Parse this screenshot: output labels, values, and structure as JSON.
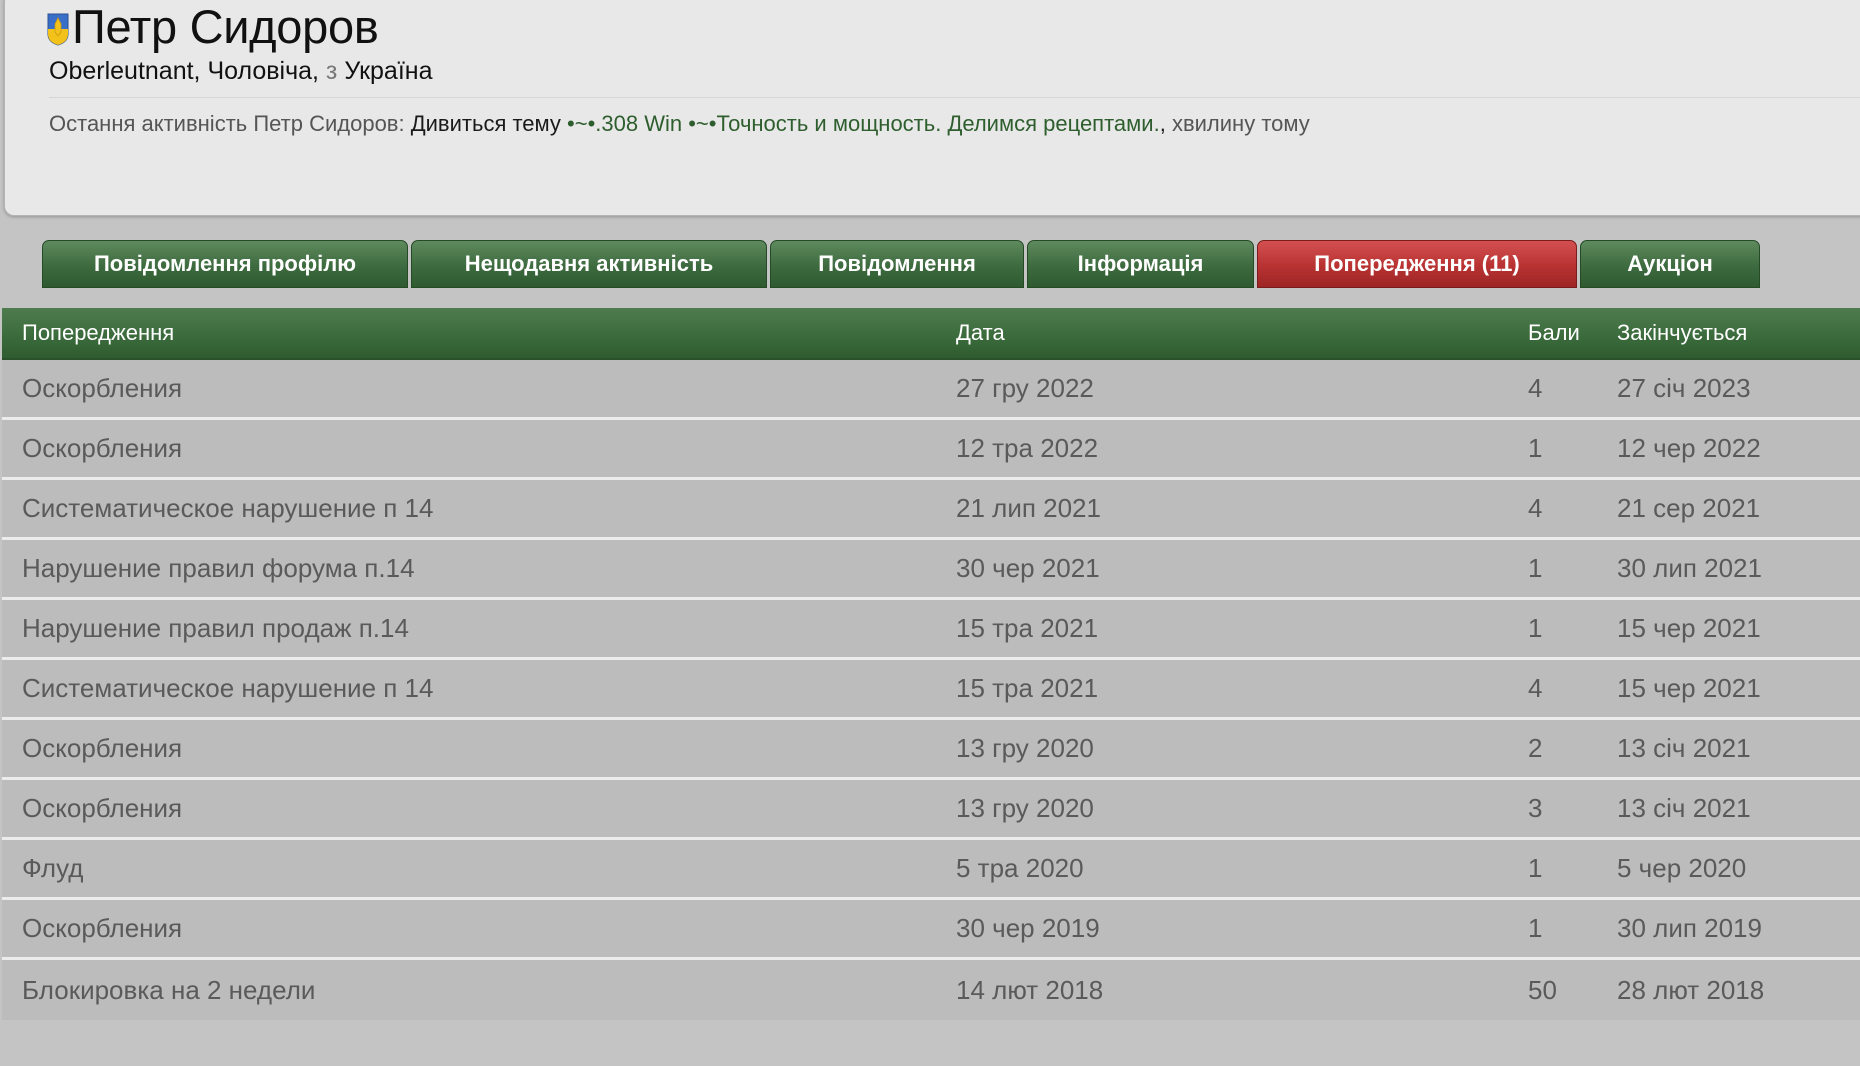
{
  "profile": {
    "name": "Петр Сидоров",
    "rank": "Oberleutnant",
    "gender": "Чоловіча,",
    "from_word": "з",
    "country": "Україна",
    "activity_label": "Остання активність Петр Сидоров:",
    "activity_action": "Дивиться тему",
    "activity_topic": "•~•.308 Win •~•Точность и мощность. Делимся рецептами.",
    "activity_sep": ",",
    "activity_time": "хвилину тому",
    "flag_icon": "ukraine-flag-shield-icon",
    "colors": {
      "flag_blue": "#3a6fc9",
      "flag_yellow": "#f2c21b",
      "link_green": "#2e5e2e"
    }
  },
  "tabs": [
    {
      "label": "Повідомлення профілю",
      "active": false
    },
    {
      "label": "Нещодавня активність",
      "active": false
    },
    {
      "label": "Повідомлення",
      "active": false
    },
    {
      "label": "Інформація",
      "active": false
    },
    {
      "label": "Попередження (11)",
      "active": true
    },
    {
      "label": "Аукціон",
      "active": false
    }
  ],
  "colors": {
    "tab_green": "#3d6a3e",
    "tab_active_red": "#b83232",
    "header_green": "#3a6a3b"
  },
  "warnings": {
    "headers": {
      "warning": "Попередження",
      "date": "Дата",
      "points": "Бали",
      "expires": "Закінчується"
    },
    "rows": [
      {
        "warning": "Оскорбления",
        "date": "27 гру 2022",
        "points": "4",
        "expires": "27 січ 2023"
      },
      {
        "warning": "Оскорбления",
        "date": "12 тра 2022",
        "points": "1",
        "expires": "12 чер 2022"
      },
      {
        "warning": "Систематическое нарушение п 14",
        "date": "21 лип 2021",
        "points": "4",
        "expires": "21 сер 2021"
      },
      {
        "warning": "Нарушение правил форума п.14",
        "date": "30 чер 2021",
        "points": "1",
        "expires": "30 лип 2021"
      },
      {
        "warning": "Нарушение правил продаж п.14",
        "date": "15 тра 2021",
        "points": "1",
        "expires": "15 чер 2021"
      },
      {
        "warning": "Систематическое нарушение п 14",
        "date": "15 тра 2021",
        "points": "4",
        "expires": "15 чер 2021"
      },
      {
        "warning": "Оскорбления",
        "date": "13 гру 2020",
        "points": "2",
        "expires": "13 січ 2021"
      },
      {
        "warning": "Оскорбления",
        "date": "13 гру 2020",
        "points": "3",
        "expires": "13 січ 2021"
      },
      {
        "warning": "Флуд",
        "date": "5 тра 2020",
        "points": "1",
        "expires": "5 чер 2020"
      },
      {
        "warning": "Оскорбления",
        "date": "30 чер 2019",
        "points": "1",
        "expires": "30 лип 2019"
      },
      {
        "warning": "Блокировка на 2 недели",
        "date": "14 лют 2018",
        "points": "50",
        "expires": "28 лют 2018"
      }
    ]
  }
}
